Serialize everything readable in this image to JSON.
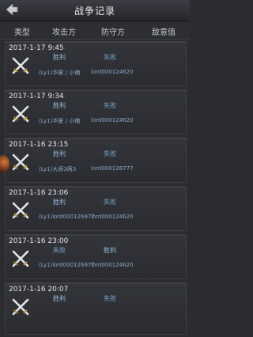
{
  "header": {
    "title": "战争记录"
  },
  "columns": {
    "type": "类型",
    "attacker": "攻击方",
    "defender": "防守方",
    "hostility": "敌意值"
  },
  "records": [
    {
      "date": "2017-1-17 9:45",
      "attacker_result": "胜利",
      "defender_result": "失败",
      "attacker": "(Ly1)华夏丿小楠",
      "defender": "lord000124620"
    },
    {
      "date": "2017-1-17 9:34",
      "attacker_result": "胜利",
      "defender_result": "失败",
      "attacker": "(Ly1)华夏丿小楠",
      "defender": "lord000124620"
    },
    {
      "date": "2017-1-16 23:15",
      "attacker_result": "胜利",
      "defender_result": "失败",
      "attacker": "(Ly1)大师3两3",
      "defender": "lord000126777"
    },
    {
      "date": "2017-1-16 23:06",
      "attacker_result": "胜利",
      "defender_result": "失败",
      "attacker": "(Ly1)lord000126977",
      "defender": "lord000124620"
    },
    {
      "date": "2017-1-16 23:00",
      "attacker_result": "失败",
      "defender_result": "胜利",
      "attacker": "(Ly1)lord000126977",
      "defender": "lord000124620"
    },
    {
      "date": "2017-1-16 20:07",
      "attacker_result": "胜利",
      "defender_result": "失败",
      "attacker": "",
      "defender": ""
    }
  ]
}
